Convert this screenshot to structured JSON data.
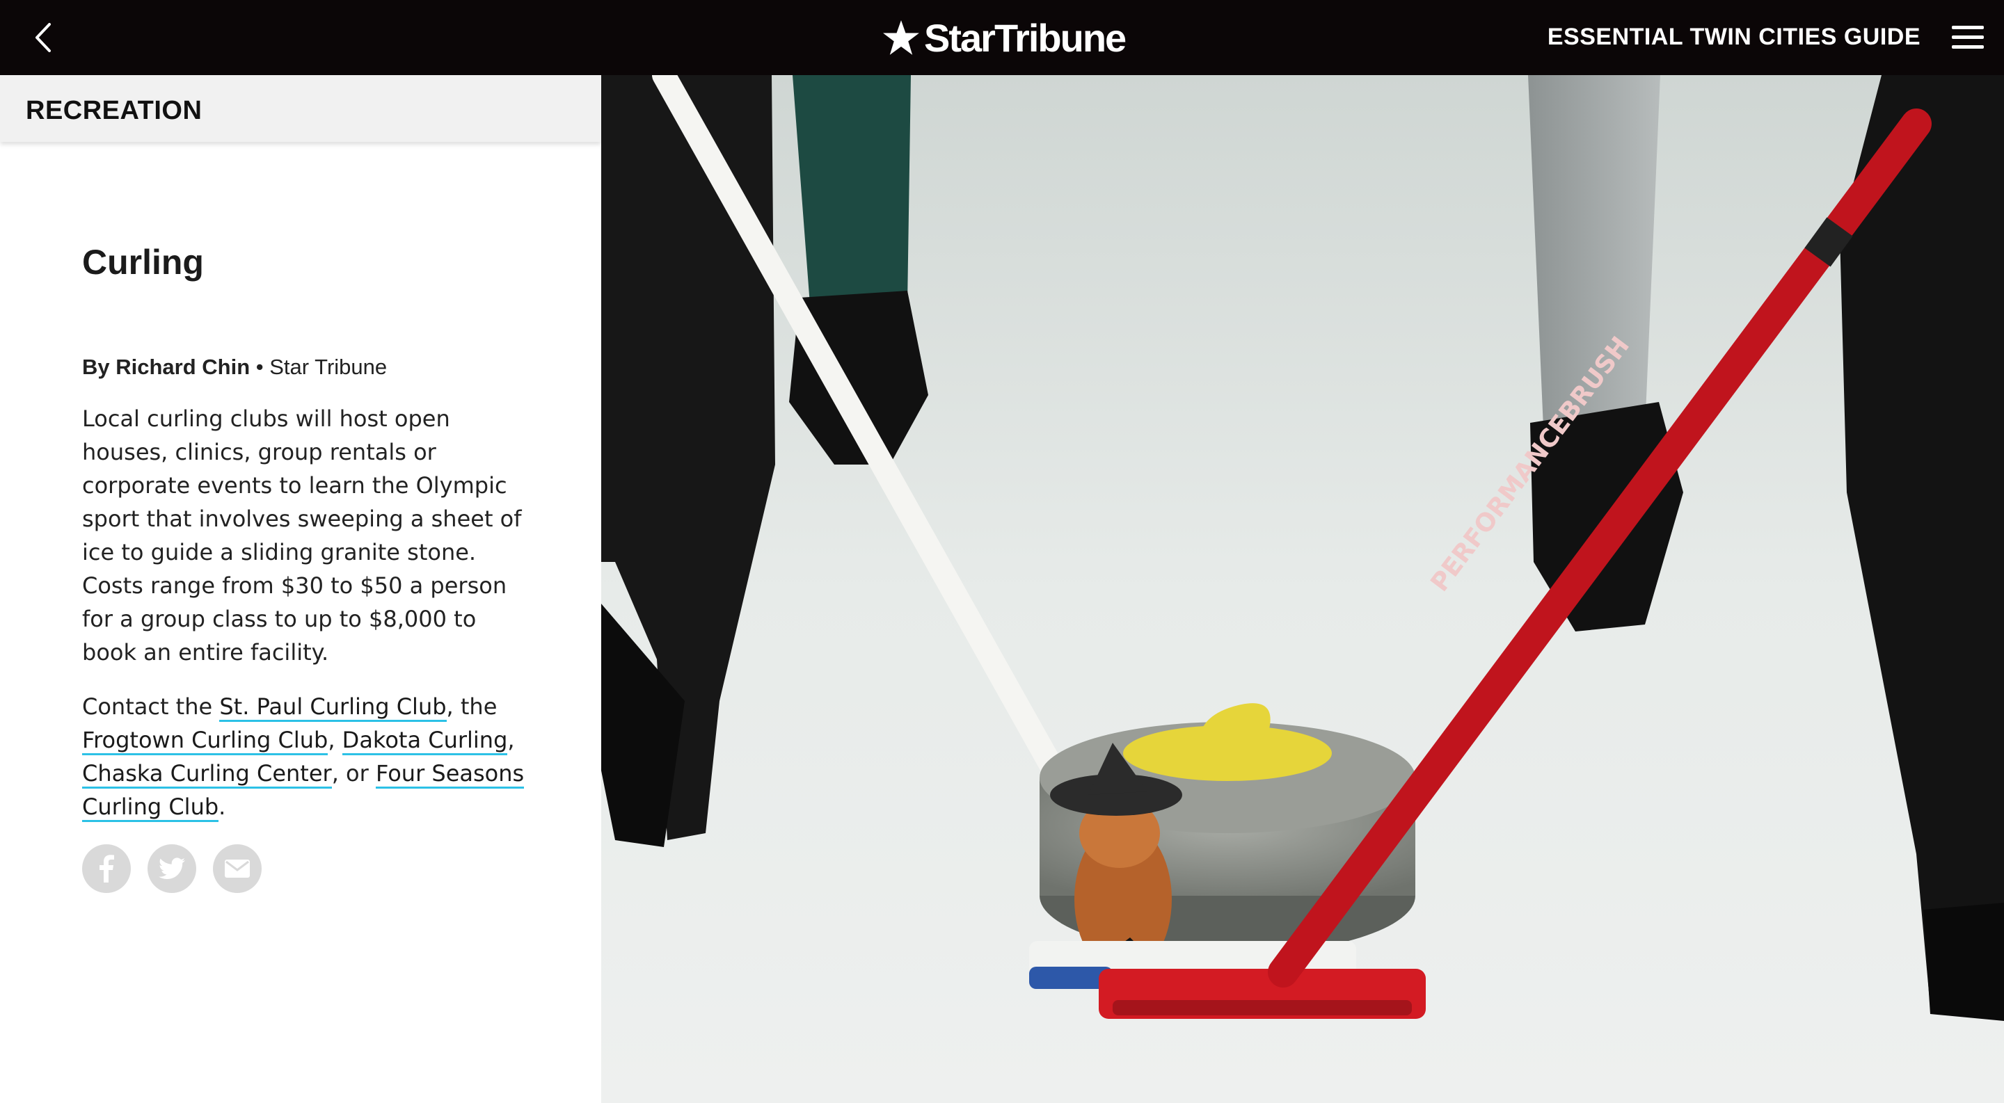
{
  "header": {
    "logo_text": "StarTribune",
    "guide_label": "ESSENTIAL TWIN CITIES GUIDE",
    "back_icon": "chevron-left-icon",
    "menu_icon": "hamburger-menu-icon"
  },
  "section": {
    "label": "RECREATION"
  },
  "article": {
    "title": "Curling",
    "byline_author": "By Richard Chin",
    "byline_separator": " • ",
    "byline_source": "Star Tribune",
    "paragraph1": "Local curling clubs will host open houses, clinics, group rentals or corporate events to learn the Olympic sport that involves sweeping a sheet of ice to guide a sliding granite stone. Costs range from $30 to $50 a person for a group class to up to $8,000 to book an entire facility.",
    "contact": {
      "prefix": "Contact the ",
      "link1": "St. Paul Curling Club",
      "sep1": ", the ",
      "link2": "Frogtown Curling Club",
      "sep2": ", ",
      "link3": "Dakota Curling",
      "sep3": ", ",
      "link4": "Chaska Curling Center",
      "sep4": ", or ",
      "link5": "Four Seasons Curling Club",
      "suffix": "."
    }
  },
  "share": {
    "facebook_icon": "facebook-icon",
    "twitter_icon": "twitter-icon",
    "email_icon": "email-icon"
  },
  "photo": {
    "broom_text": "PERFORMANCEBRUSH"
  },
  "colors": {
    "header_bg": "#0b0607",
    "section_bar_bg": "#f1f1f1",
    "link_underline": "#2cc1e6",
    "share_icon_bg": "#d9d9d9"
  }
}
